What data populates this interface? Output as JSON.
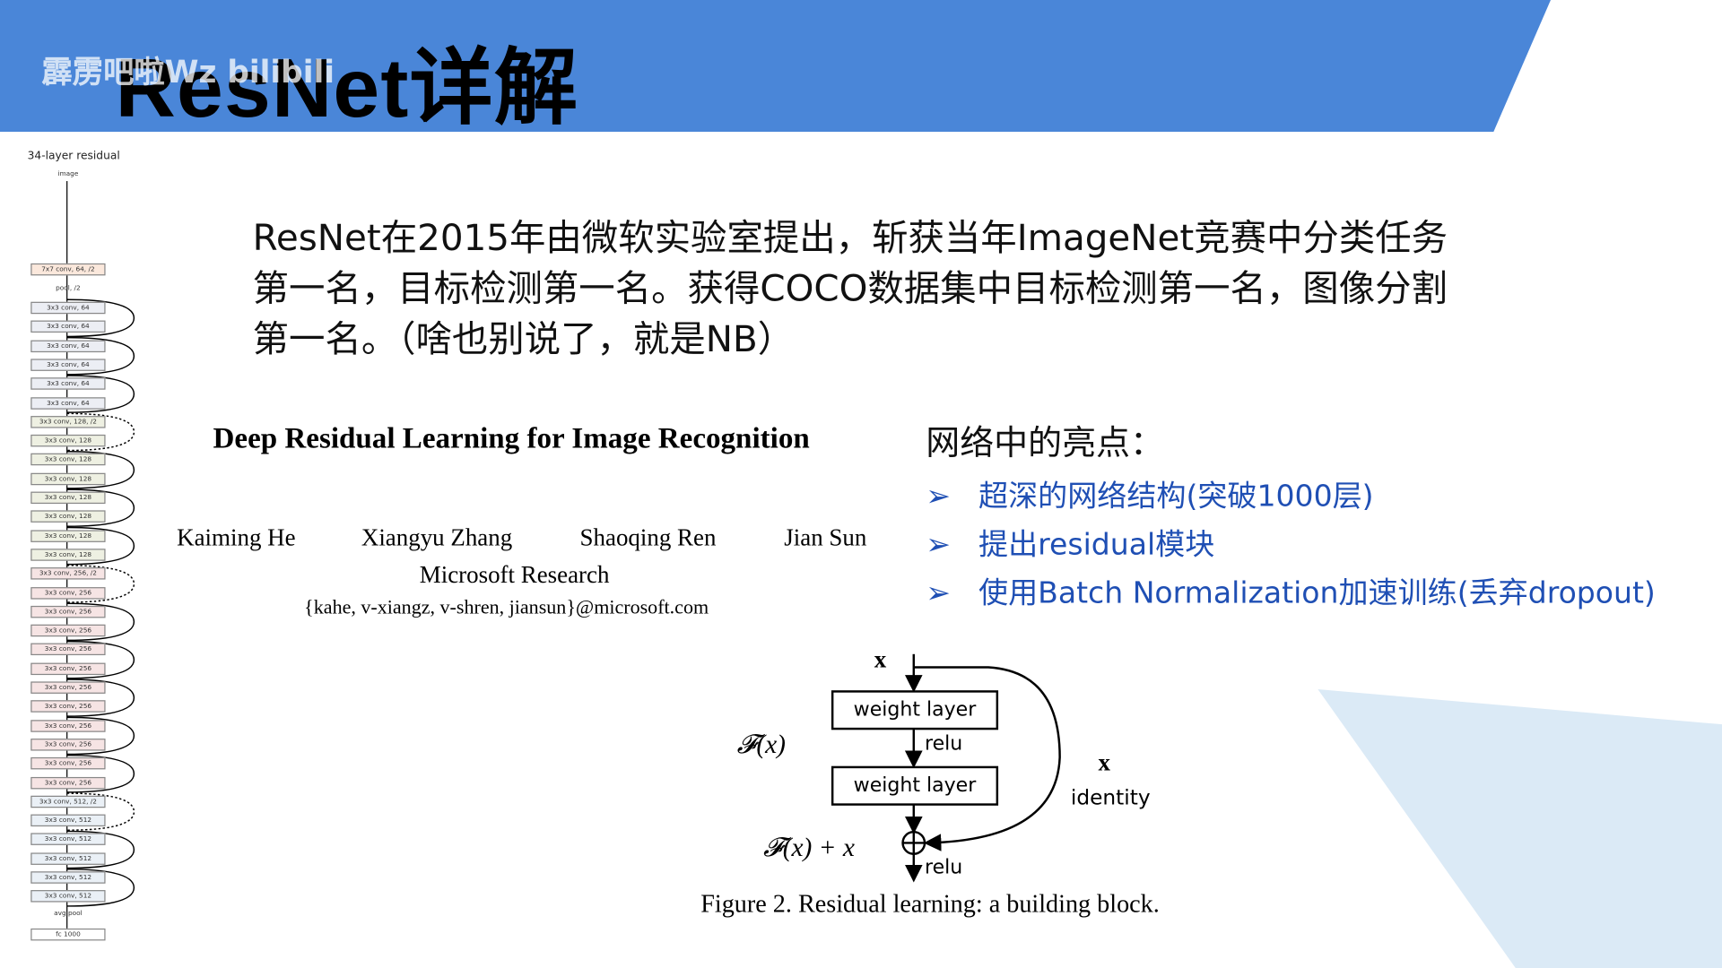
{
  "header": {
    "title": "ResNet详解",
    "watermark": "霹雳吧啦Wz bilibili",
    "banner_color": "#4a86d8"
  },
  "intro": "ResNet在2015年由微软实验室提出，斩获当年ImageNet竞赛中分类任务第一名，目标检测第一名。获得COCO数据集中目标检测第一名，图像分割第一名。（啥也别说了，就是NB）",
  "paper": {
    "title": "Deep Residual Learning for Image Recognition",
    "authors": [
      "Kaiming He",
      "Xiangyu Zhang",
      "Shaoqing Ren",
      "Jian Sun"
    ],
    "affiliation": "Microsoft Research",
    "emails": "{kahe, v-xiangz, v-shren, jiansun}@microsoft.com"
  },
  "highlights": {
    "title": "网络中的亮点：",
    "items": [
      "超深的网络结构(突破1000层)",
      "提出residual模块",
      "使用Batch Normalization加速训练(丢弃dropout)"
    ],
    "color": "#1f4fb4"
  },
  "block": {
    "x": "x",
    "weight1": "weight layer",
    "relu1": "relu",
    "weight2": "weight layer",
    "fx": "𝓕(x)",
    "identity_x": "x",
    "identity": "identity",
    "sum": "𝓕(x) + x",
    "relu2": "relu",
    "caption": "Figure 2. Residual learning: a building block."
  },
  "net": {
    "title": "34-layer residual",
    "input": "image",
    "first": "7x7 conv, 64, /2",
    "pool": "pool, /2",
    "layers": [
      "3x3 conv, 64",
      "3x3 conv, 64",
      "3x3 conv, 64",
      "3x3 conv, 64",
      "3x3 conv, 64",
      "3x3 conv, 64",
      "3x3 conv, 128, /2",
      "3x3 conv, 128",
      "3x3 conv, 128",
      "3x3 conv, 128",
      "3x3 conv, 128",
      "3x3 conv, 128",
      "3x3 conv, 128",
      "3x3 conv, 128",
      "3x3 conv, 256, /2",
      "3x3 conv, 256",
      "3x3 conv, 256",
      "3x3 conv, 256",
      "3x3 conv, 256",
      "3x3 conv, 256",
      "3x3 conv, 256",
      "3x3 conv, 256",
      "3x3 conv, 256",
      "3x3 conv, 256",
      "3x3 conv, 256",
      "3x3 conv, 256",
      "3x3 conv, 512, /2",
      "3x3 conv, 512",
      "3x3 conv, 512",
      "3x3 conv, 512",
      "3x3 conv, 512",
      "3x3 conv, 512"
    ],
    "avgpool": "avg pool",
    "fc": "fc 1000"
  }
}
